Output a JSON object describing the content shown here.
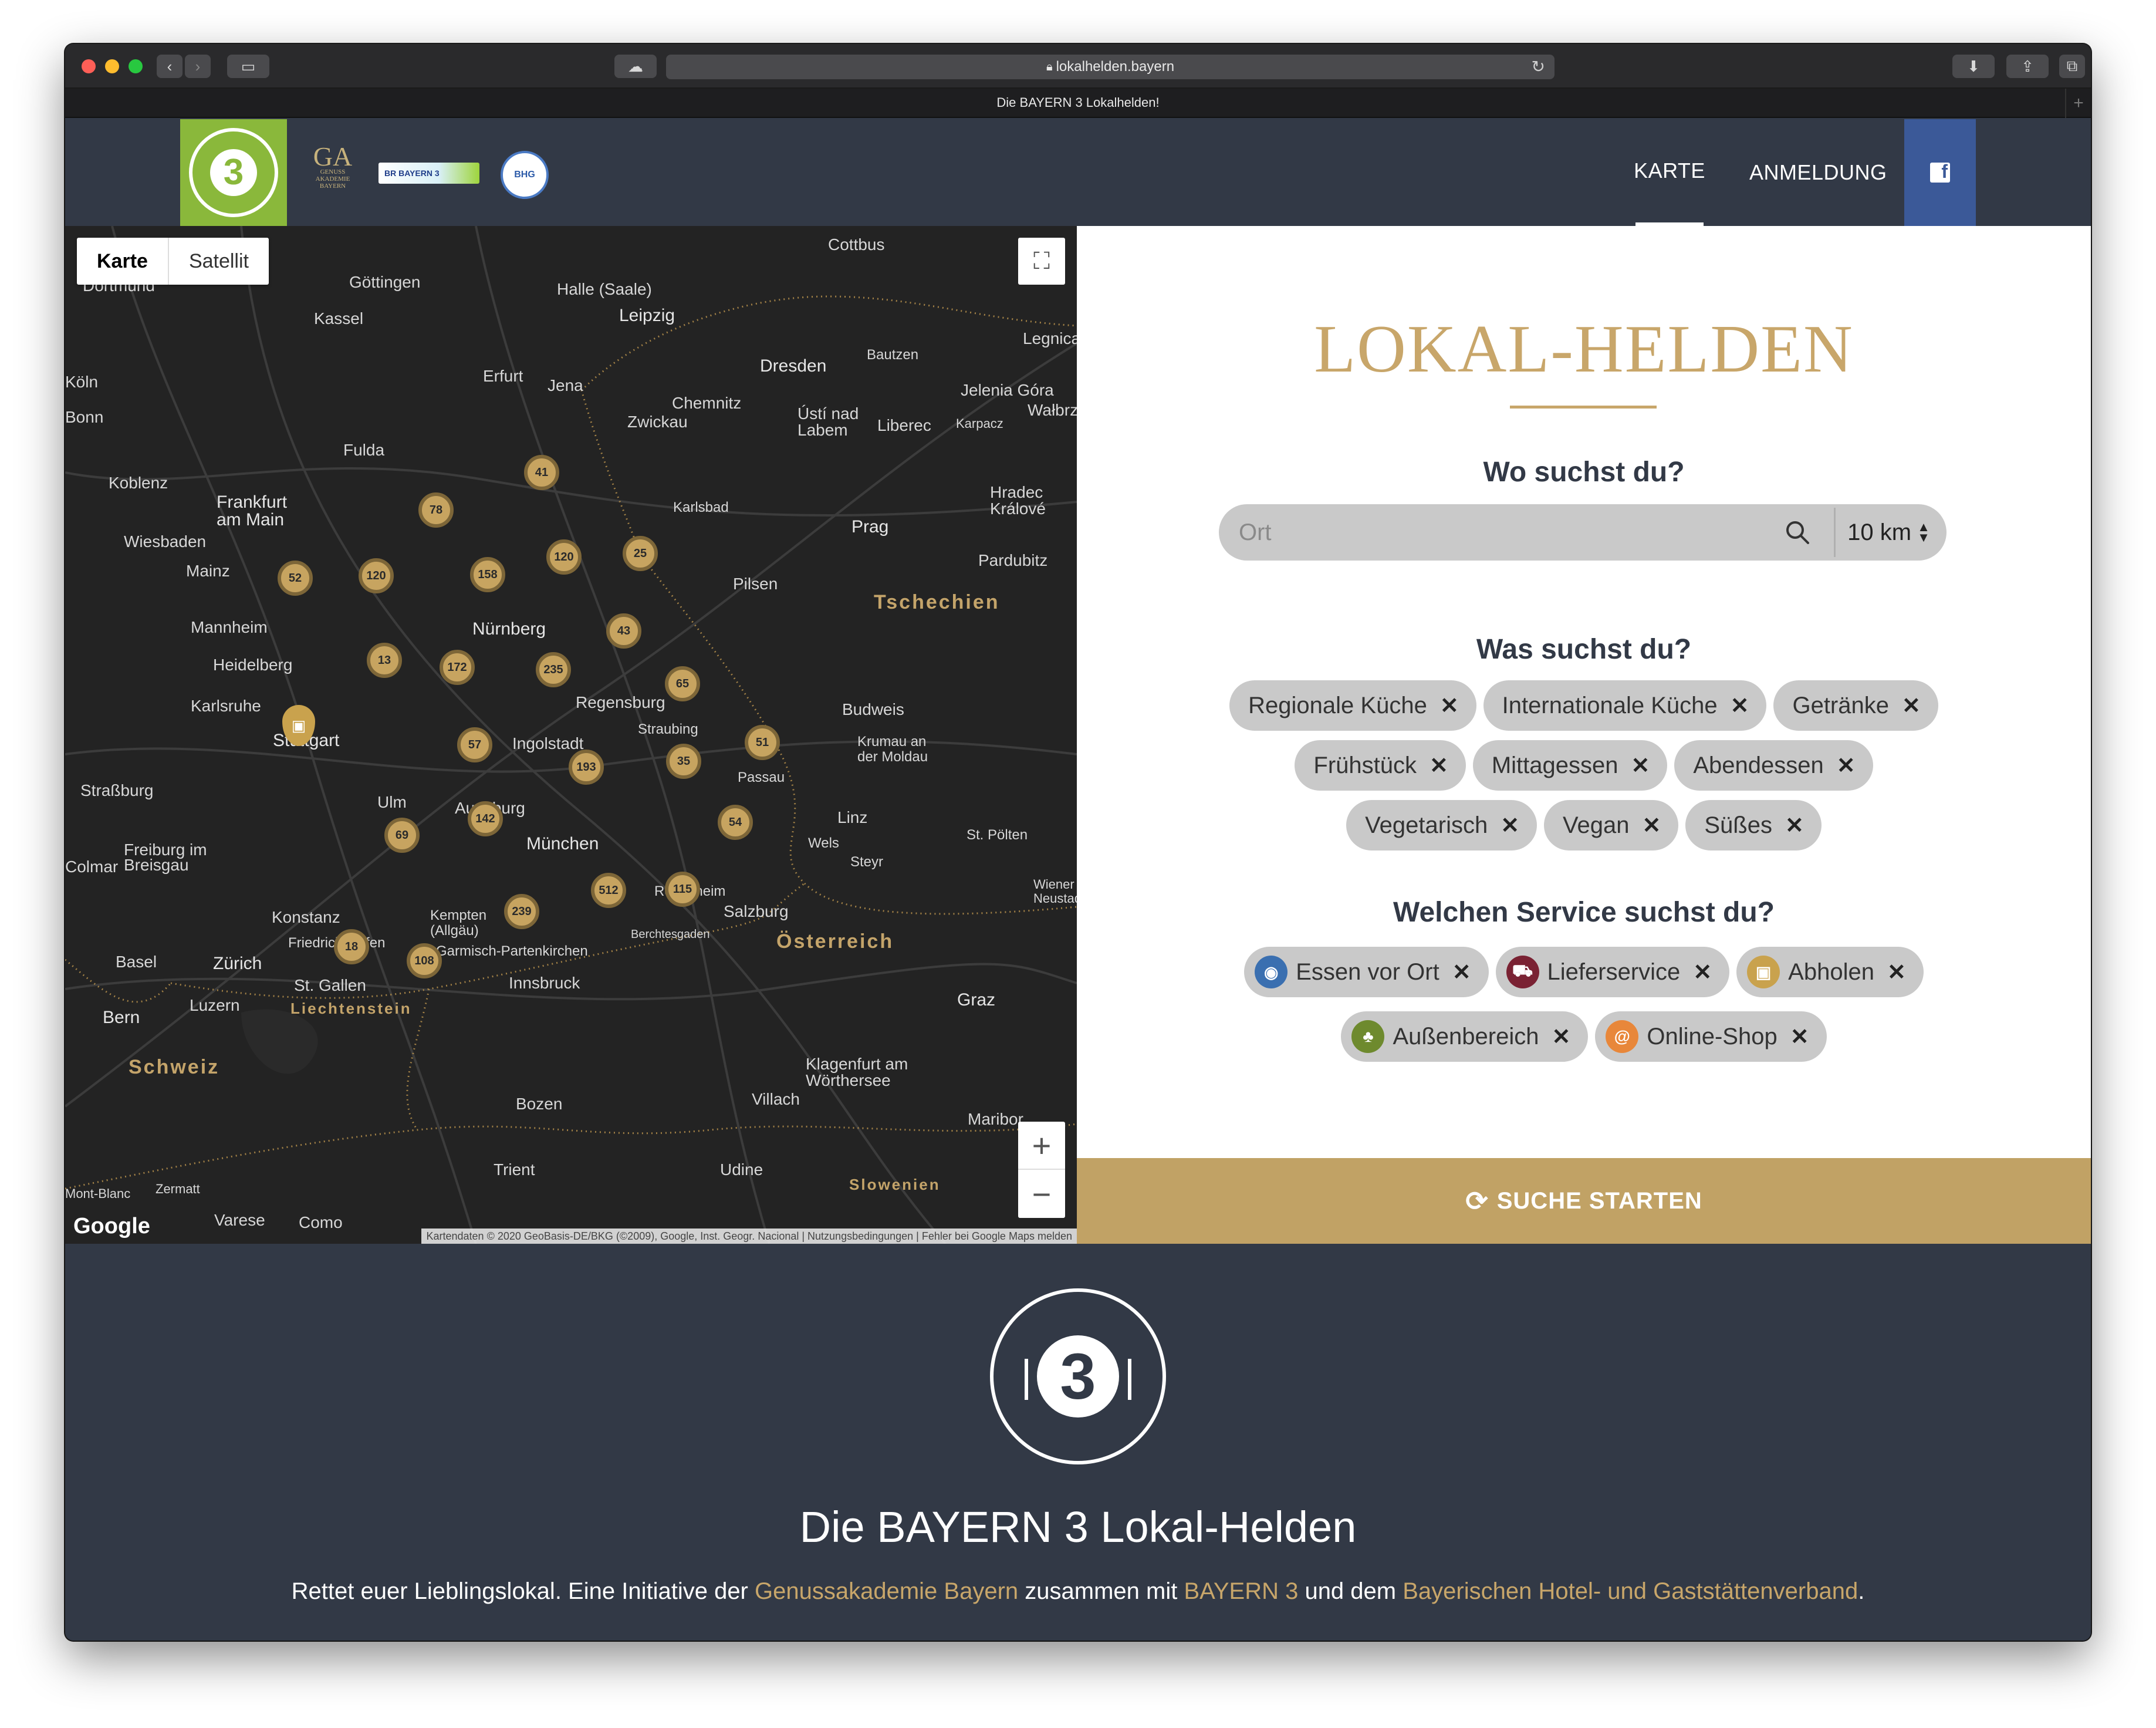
{
  "browser": {
    "url": "lokalhelden.bayern",
    "tab_title": "Die BAYERN 3 Lokalhelden!"
  },
  "header": {
    "logo_alt": "Lokal Helden 3",
    "partners": [
      "Genussakademie Bayern",
      "BAYERN 3",
      "BHG"
    ],
    "nav": [
      {
        "label": "KARTE",
        "active": true
      },
      {
        "label": "ANMELDUNG",
        "active": false
      }
    ]
  },
  "map": {
    "toggle": [
      "Karte",
      "Satellit"
    ],
    "google_label": "Google",
    "attribution": "Kartendaten © 2020 GeoBasis-DE/BKG (©2009), Google, Inst. Geogr. Nacional | Nutzungsbedingungen | Fehler bei Google Maps melden",
    "cities": [
      "Dortmund",
      "Göttingen",
      "Kassel",
      "Halle (Saale)",
      "Leipzig",
      "Cottbus",
      "Dresden",
      "Bautzen",
      "Legnica",
      "Erfurt",
      "Jena",
      "Chemnitz",
      "Zwickau",
      "Jelenia Góra",
      "Wałbrzych",
      "Ústí nad Labem",
      "Liberec",
      "Karpacz",
      "Köln",
      "Bonn",
      "Fulda",
      "Koblenz",
      "Frankfurt am Main",
      "Wiesbaden",
      "Mainz",
      "Karlsbad",
      "Hradec Králové",
      "Prag",
      "Pardubitz",
      "Pilsen",
      "Mannheim",
      "Heidelberg",
      "Nürnberg",
      "Regensburg",
      "Straubing",
      "Budweis",
      "Krumau an der Moldau",
      "Karlsruhe",
      "Stuttgart",
      "Ingolstadt",
      "Passau",
      "Straßburg",
      "Ulm",
      "Augsburg",
      "München",
      "Linz",
      "Wels",
      "Steyr",
      "St. Pölten",
      "Freiburg im Breisgau",
      "Colmar",
      "Konstanz",
      "Friedrichshafen",
      "Kempten (Allgäu)",
      "Garmisch-Partenkirchen",
      "Rosenheim",
      "Salzburg",
      "Berchtesgaden",
      "Basel",
      "Zürich",
      "St. Gallen",
      "Innsbruck",
      "Bern",
      "Luzern",
      "Graz",
      "Klagenfurt am Wörthersee",
      "Villach",
      "Bozen",
      "Trient",
      "Udine",
      "Maribor",
      "Mont-Blanc",
      "Zermatt",
      "Varese",
      "Como",
      "Wiener Neustadt"
    ],
    "countries": [
      "Tschechien",
      "Österreich",
      "Schweiz",
      "Liechtenstein",
      "Slowenien"
    ],
    "clusters": [
      {
        "label": "41"
      },
      {
        "label": "78"
      },
      {
        "label": "52"
      },
      {
        "label": "120"
      },
      {
        "label": "158"
      },
      {
        "label": "120"
      },
      {
        "label": "25"
      },
      {
        "label": "43"
      },
      {
        "label": "13"
      },
      {
        "label": "172"
      },
      {
        "label": "235"
      },
      {
        "label": "65"
      },
      {
        "label": "57"
      },
      {
        "label": "193"
      },
      {
        "label": "35"
      },
      {
        "label": "51"
      },
      {
        "label": "69"
      },
      {
        "label": "142"
      },
      {
        "label": "54"
      },
      {
        "label": "512"
      },
      {
        "label": "115"
      },
      {
        "label": "239"
      },
      {
        "label": "18"
      },
      {
        "label": "108"
      }
    ]
  },
  "panel": {
    "title": "LOKAL-HELDEN",
    "where_heading": "Wo suchst du?",
    "search_placeholder": "Ort",
    "radius": "10 km",
    "what_heading": "Was suchst du?",
    "categories": [
      [
        "Regionale Küche",
        "Internationale Küche",
        "Getränke"
      ],
      [
        "Frühstück",
        "Mittagessen",
        "Abendessen"
      ],
      [
        "Vegetarisch",
        "Vegan",
        "Süßes"
      ]
    ],
    "service_heading": "Welchen Service suchst du?",
    "services": [
      [
        {
          "label": "Essen vor Ort",
          "color": "#3a6fb0",
          "icon": "plate-icon"
        },
        {
          "label": "Lieferservice",
          "color": "#7a2233",
          "icon": "scooter-icon"
        },
        {
          "label": "Abholen",
          "color": "#c9a24d",
          "icon": "bag-icon"
        }
      ],
      [
        {
          "label": "Außenbereich",
          "color": "#6e8a2e",
          "icon": "tree-icon"
        },
        {
          "label": "Online-Shop",
          "color": "#e8873a",
          "icon": "at-icon"
        }
      ]
    ],
    "start_label": "SUCHE STARTEN"
  },
  "footer": {
    "title": "Die BAYERN 3 Lokal-Helden",
    "text_pre": "Rettet euer Lieblingslokal. Eine Initiative der ",
    "link1": "Genussakademie Bayern",
    "text_mid": " zusammen mit ",
    "link2": "BAYERN 3",
    "text_mid2": " und dem ",
    "link3": "Bayerischen Hotel- und Gaststättenverband",
    "text_end": "."
  }
}
